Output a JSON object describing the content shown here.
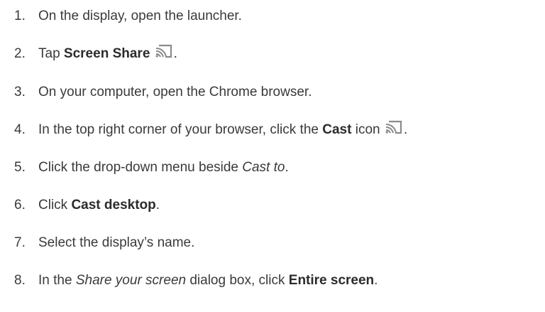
{
  "steps": [
    {
      "number": "1.",
      "text": "On the display, open the launcher."
    },
    {
      "number": "2.",
      "prefix": "Tap ",
      "bold": "Screen Share",
      "icon": "cast-icon",
      "suffix": "."
    },
    {
      "number": "3.",
      "text": "On your computer, open the Chrome browser."
    },
    {
      "number": "4.",
      "prefix": "In the top right corner of your browser, click the ",
      "bold": "Cast",
      "middle": " icon",
      "icon": "cast-icon",
      "suffix": "."
    },
    {
      "number": "5.",
      "prefix": "Click the drop-down menu beside ",
      "italic": "Cast to",
      "suffix": "."
    },
    {
      "number": "6.",
      "prefix": "Click ",
      "bold": "Cast desktop",
      "suffix": "."
    },
    {
      "number": "7.",
      "text": "Select the display’s name."
    },
    {
      "number": "8.",
      "prefix": "In the ",
      "italic": "Share your screen",
      "middle": " dialog box, click ",
      "bold": "Entire screen",
      "suffix": "."
    }
  ],
  "colors": {
    "text": "#3a3a3a",
    "icon": "#8a8a8a"
  }
}
